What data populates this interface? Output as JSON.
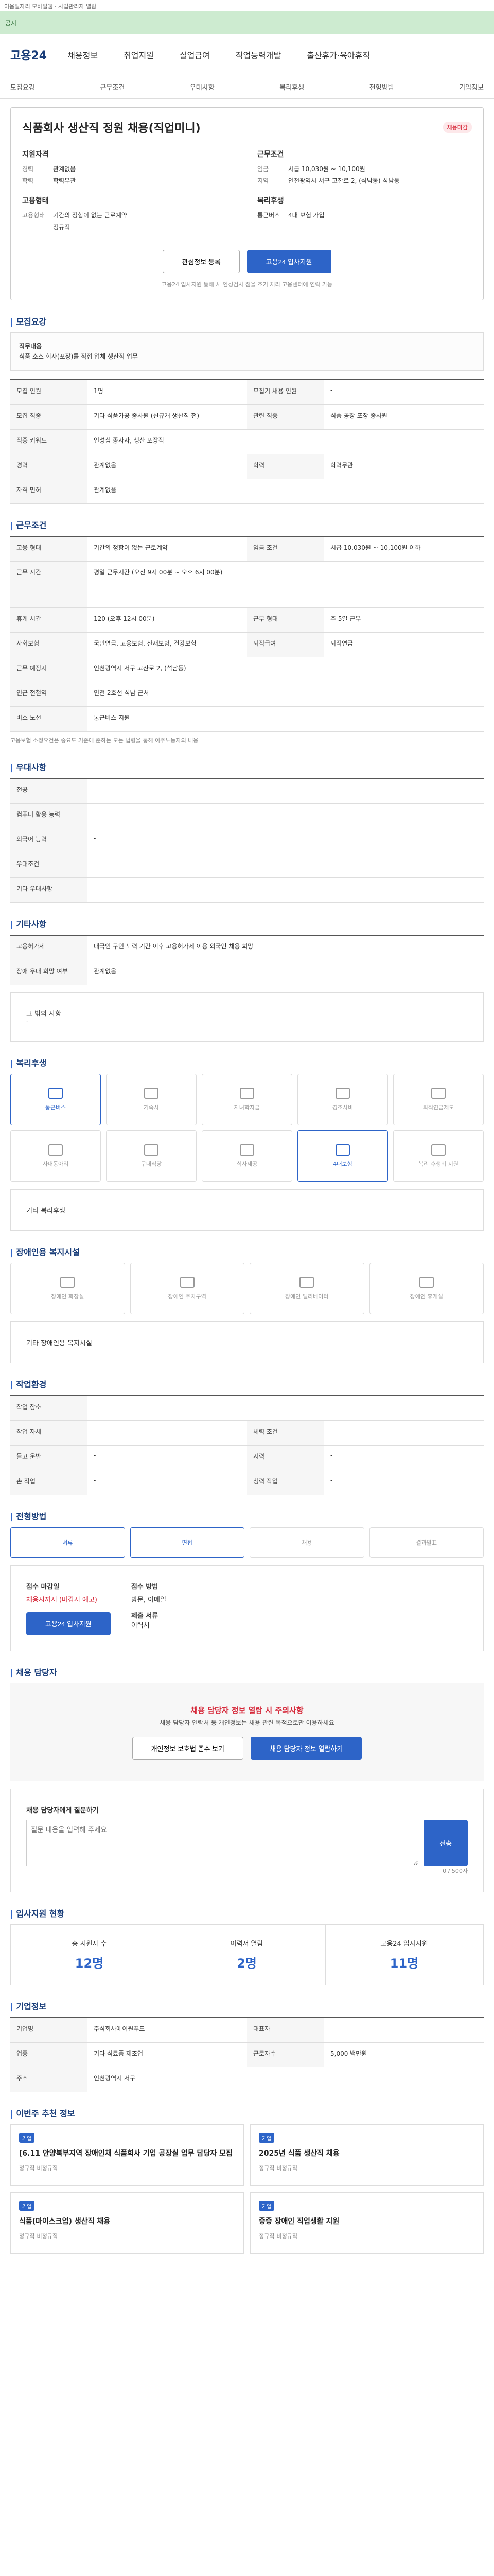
{
  "topbar": "이음일자리 모바일웹 · 사업관리자 열람",
  "banner": "공지",
  "header": {
    "logo": "고용24",
    "nav": [
      "채용정보",
      "취업지원",
      "실업급여",
      "직업능력개발",
      "출산휴가·육아휴직"
    ]
  },
  "snb": [
    "모집요강",
    "근무조건",
    "우대사항",
    "복리후생",
    "전형방법",
    "기업정보"
  ],
  "job": {
    "title": "식품회사 생산직 정원 채용(직업미니)",
    "badge": "채용마감",
    "left_title": "지원자격",
    "left": [
      [
        "경력",
        "관계없음"
      ],
      [
        "학력",
        "학력무관"
      ]
    ],
    "left2_title": "고용형태",
    "left2": [
      [
        "고용형태",
        "기간의 정함이 없는 근로계약"
      ],
      [
        "",
        "정규직"
      ]
    ],
    "right_title": "근무조건",
    "right": [
      [
        "임금",
        "시급 10,030원 ~ 10,100원"
      ],
      [
        "지역",
        "인천광역시 서구 고잔로 2, (석남동) 석남동"
      ]
    ],
    "right2_title": "복리후생",
    "right2": [
      "통근버스",
      "4대 보험 가입"
    ],
    "btn_fav": "관심정보 등록",
    "btn_apply": "고용24 입사지원",
    "note": "고용24 입사지원 통해 시 인성검사 점을 조기 처리 고용센터에 연락 가능"
  },
  "recruit": {
    "title": "모집요강",
    "duty_label": "직무내용",
    "duty": "식품 소스 회사(포장)를 직접 업체 생산직 업무",
    "rows": [
      [
        "모집 인원",
        "1명",
        "모집기 채용 인원",
        "-"
      ],
      [
        "모집 직종",
        "기타 식품가공 종사원 (신규개 생산직 전)",
        "관련 직종",
        "식품 공장 포장 종사원"
      ],
      [
        "직종 키워드",
        "인성심 종사자, 생산 포장직",
        "",
        " "
      ],
      [
        "경력",
        "관계없음",
        "학력",
        "학력무관"
      ],
      [
        "자격 면허",
        "관계없음",
        "",
        ""
      ]
    ]
  },
  "work": {
    "title": "근무조건",
    "rows": [
      [
        "고용 형태",
        "기간의 정함이 없는 근로계약",
        "임금 조건",
        "시급 10,030원 ~ 10,100원 이하"
      ],
      [
        "근무 시간",
        "평일 근무시간 (오전 9시 00분 ~ 오후 6시 00분)",
        "",
        ""
      ],
      [
        "휴게 시간",
        "120 (오후 12시 00분)",
        "근무 형태",
        "주 5일 근무"
      ],
      [
        "사회보험",
        "국민연금, 고용보험, 산재보험, 건강보험",
        "퇴직급여",
        "퇴직연금"
      ],
      [
        "근무 예정지",
        "인천광역시 서구 고잔로 2, (석남동)",
        "",
        ""
      ],
      [
        "인근 전철역",
        "인천 2호선 석남 근처",
        "",
        ""
      ],
      [
        "버스 노선",
        "통근버스 지원",
        "",
        ""
      ]
    ],
    "note": "고용보험 소정요건은 중요도 기준에 준하는 모든 법령을 통해 이주노동자의 내용"
  },
  "pref": {
    "title": "우대사항",
    "rows": [
      [
        "전공",
        "-"
      ],
      [
        "컴퓨터 활용 능력",
        "-"
      ],
      [
        "외국어 능력",
        "-"
      ],
      [
        "우대조건",
        "-"
      ],
      [
        "기타 우대사항",
        "-"
      ]
    ]
  },
  "etc": {
    "title": "기타사항",
    "rows": [
      [
        "고용허가제",
        "내국인 구인 노력 기간 이후 고용허가제 이용 외국인 채용 희망"
      ],
      [
        "장애 우대 희망 여부",
        "관계없음"
      ]
    ],
    "note": "그 밖의 사항",
    "val": "-"
  },
  "welfare": {
    "title": "복리후생",
    "items": [
      "통근버스",
      "기숙사",
      "자녀학자금",
      "경조사비",
      "퇴직연금제도",
      "사내동아리",
      "구내식당",
      "식사제공",
      "4대보험",
      "복리 후생비 지원"
    ],
    "etc": "기타 복리후생"
  },
  "disabled": {
    "title": "장애인용 복지시설",
    "items": [
      "장애인 화장실",
      "장애인 주차구역",
      "장애인 엘리베이터",
      "장애인 휴게실"
    ],
    "etc": "기타 장애인용 복지시설"
  },
  "env": {
    "title": "작업환경",
    "rows": [
      [
        "작업 장소",
        "-",
        "",
        ""
      ],
      [
        "작업 자세",
        "-",
        "체력 조건",
        "-"
      ],
      [
        "들고 운반",
        "-",
        "시력",
        "-"
      ],
      [
        "손 작업",
        "-",
        "청력 작업",
        "-"
      ]
    ]
  },
  "process": {
    "title": "전형방법",
    "steps": [
      "서류",
      "면접",
      "채용",
      "결과발표"
    ],
    "deadline_label": "접수 마감일",
    "deadline": "채용시까지 (마감시 예고)",
    "method_label": "접수 방법",
    "method": "방문, 이메일",
    "docs_label": "제출 서류",
    "docs": "이력서",
    "apply": "고용24 입사지원"
  },
  "contact": {
    "title": "채용 담당자",
    "warn1": "채용 담당자 정보 열람 시 주의사항",
    "warn2": "채용 담당자 연락처 등 개인정보는 채용 관련 목적으로만 이용하세요",
    "btn_a": "개인정보 보호법 준수 보기",
    "btn_b": "채용 담당자 정보 열람하기"
  },
  "qna": {
    "title": "채용 담당자에게 질문하기",
    "placeholder": "질문 내용을 입력해 주세요",
    "btn": "전송",
    "count": "0 / 500자"
  },
  "status": {
    "title": "입사지원 현황",
    "items": [
      [
        "총 지원자 수",
        "12명"
      ],
      [
        "이력서 열람",
        "2명"
      ],
      [
        "고용24 입사지원",
        "11명"
      ]
    ]
  },
  "company": {
    "title": "기업정보",
    "name_label": "기업명",
    "name": "주식회사에이원푸드",
    "rep_label": "대표자",
    "rep": "-",
    "biz_label": "업종",
    "biz": "기타 식료품 제조업",
    "emp_label": "근로자수",
    "emp": "5,000 백만원",
    "addr_label": "주소",
    "addr": "인천광역시 서구"
  },
  "related": {
    "title": "이번주 추천 정보",
    "items": [
      [
        "기업",
        "[6.11 안양북부지역 장애인채 식품회사 기업 공장실 업무 담당자 모집",
        "정규직",
        "비정규직"
      ],
      [
        "기업",
        "2025년 식품 생산직 채용",
        "정규직",
        "비정규직"
      ],
      [
        "기업",
        "식품(마이스크업) 생산직 채용",
        "정규직",
        "비정규직"
      ],
      [
        "기업",
        "중증 장애인 직업생활 지원",
        "정규직",
        "비정규직"
      ]
    ]
  }
}
